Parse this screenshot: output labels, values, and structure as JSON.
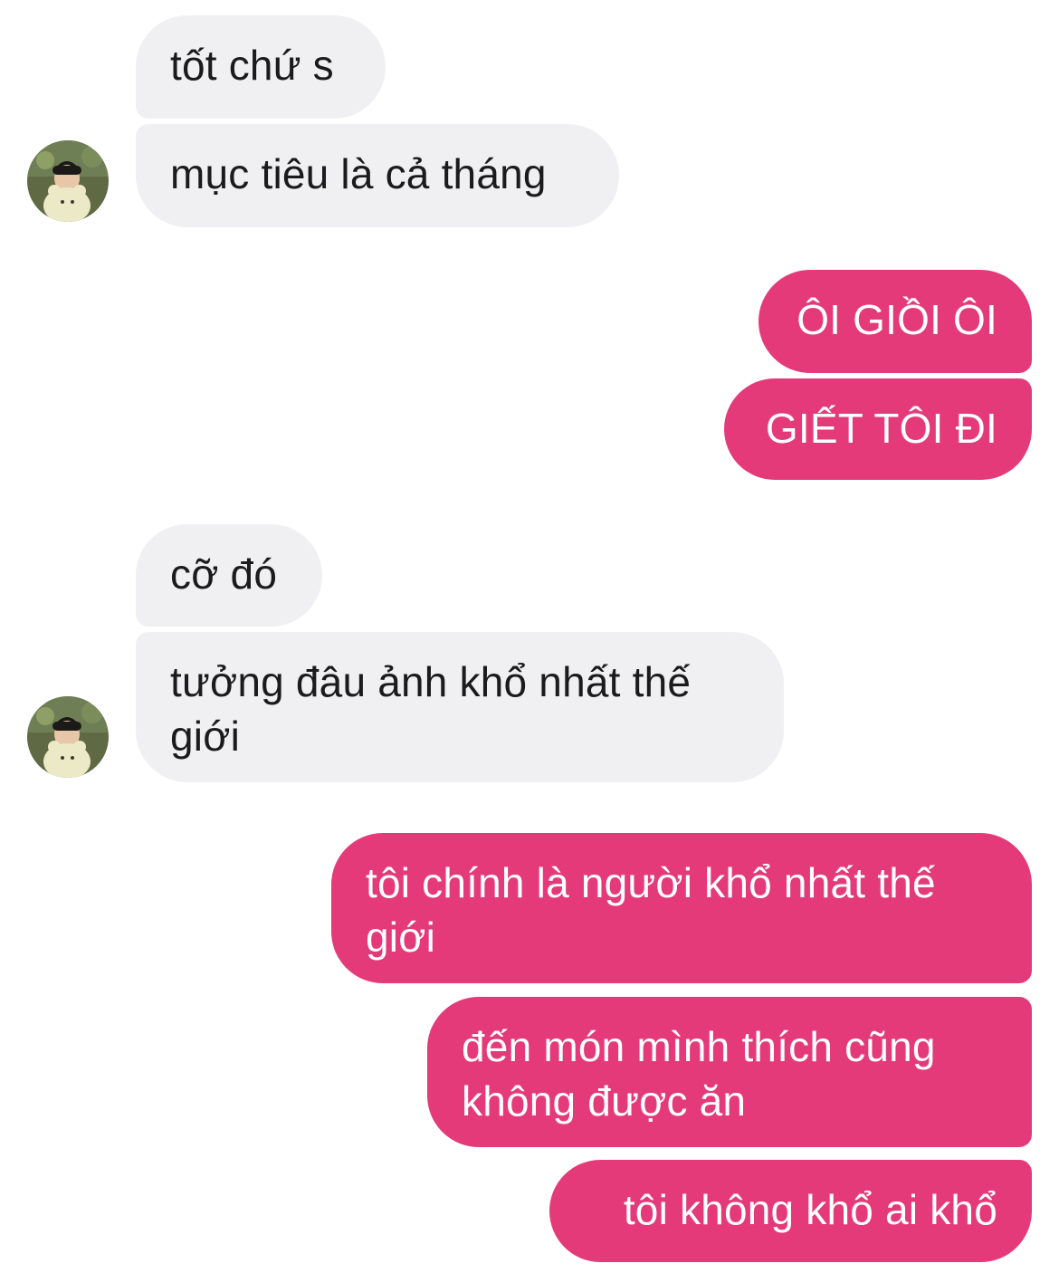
{
  "conversation": {
    "colors": {
      "incoming_bubble": "#f0f0f3",
      "incoming_text": "#1b1b1d",
      "outgoing_bubble": "#e43a79",
      "outgoing_text": "#ffffff"
    },
    "messages": [
      {
        "sender": "other",
        "text": "tốt chứ s"
      },
      {
        "sender": "other",
        "text": "mục tiêu là cả tháng"
      },
      {
        "sender": "me",
        "text": "ÔI GIỒI ÔI"
      },
      {
        "sender": "me",
        "text": "GIẾT TÔI ĐI"
      },
      {
        "sender": "other",
        "text": "cỡ đó"
      },
      {
        "sender": "other",
        "text": "tưởng đâu ảnh khổ nhất thế giới"
      },
      {
        "sender": "me",
        "text": "tôi chính là người khổ nhất thế giới"
      },
      {
        "sender": "me",
        "text": "đến món mình thích cũng không được ăn"
      },
      {
        "sender": "me",
        "text": "tôi không khổ ai khổ"
      }
    ],
    "avatar_icon": "contact-avatar-photo"
  }
}
